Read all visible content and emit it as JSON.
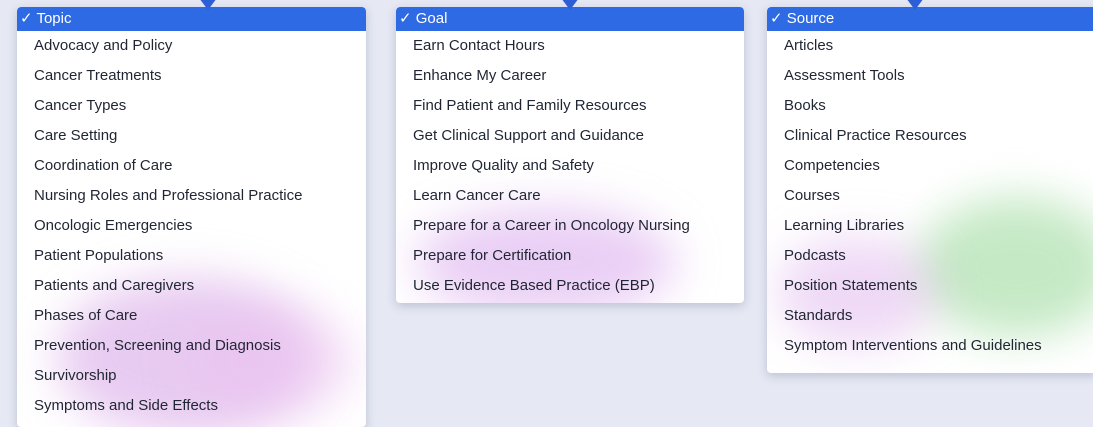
{
  "filters": [
    {
      "id": "topic",
      "header": "✓ Topic",
      "items": [
        "Advocacy and Policy",
        "Cancer Treatments",
        "Cancer Types",
        "Care Setting",
        "Coordination of Care",
        "Nursing Roles and Professional Practice",
        "Oncologic Emergencies",
        "Patient Populations",
        "Patients and Caregivers",
        "Phases of Care",
        "Prevention, Screening and Diagnosis",
        "Survivorship",
        "Symptoms and Side Effects"
      ]
    },
    {
      "id": "goal",
      "header": "✓ Goal",
      "items": [
        "Earn Contact Hours",
        "Enhance My Career",
        "Find Patient and Family Resources",
        "Get Clinical Support and Guidance",
        "Improve Quality and Safety",
        "Learn Cancer Care",
        "Prepare for a Career in Oncology Nursing",
        "Prepare for Certification",
        "Use Evidence Based Practice (EBP)"
      ]
    },
    {
      "id": "source",
      "header": "✓ Source",
      "items": [
        "Articles",
        "Assessment Tools",
        "Books",
        "Clinical Practice Resources",
        "Competencies",
        "Courses",
        "Learning Libraries",
        "Podcasts",
        "Position Statements",
        "Standards",
        "Symptom Interventions and Guidelines"
      ]
    }
  ],
  "colors": {
    "background": "#e6e9f4",
    "header": "#2e6ae3",
    "pointer": "#2c5fd6",
    "text": "#1f2533"
  }
}
